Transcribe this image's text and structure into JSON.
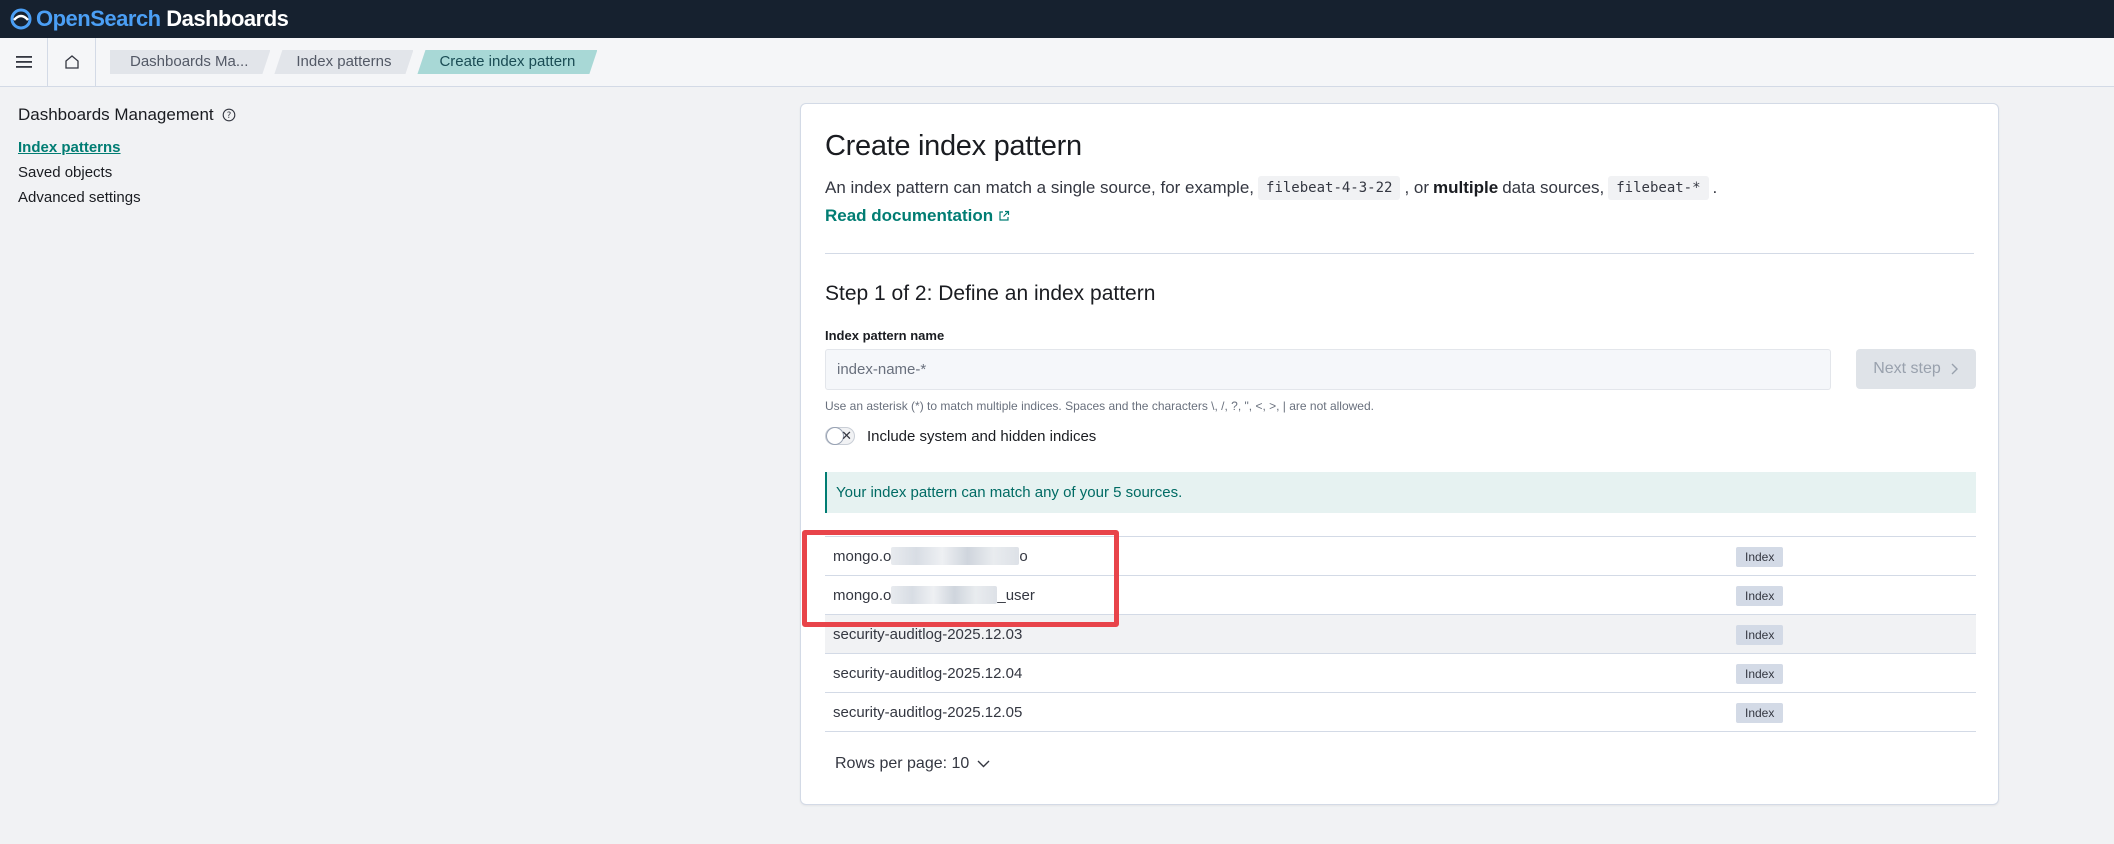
{
  "header": {
    "brand_open": "Open",
    "brand_search": "Search",
    "brand_dashboards": " Dashboards"
  },
  "breadcrumbs": [
    {
      "label": "Dashboards Ma..."
    },
    {
      "label": "Index patterns"
    },
    {
      "label": "Create index pattern"
    }
  ],
  "sidebar": {
    "title": "Dashboards Management",
    "items": [
      {
        "label": "Index patterns",
        "active": true
      },
      {
        "label": "Saved objects",
        "active": false
      },
      {
        "label": "Advanced settings",
        "active": false
      }
    ]
  },
  "page": {
    "title": "Create index pattern",
    "desc_1": "An index pattern can match a single source, for example,",
    "desc_code_1": "filebeat-4-3-22",
    "desc_2": ", or",
    "desc_bold": "multiple",
    "desc_3": "data sources,",
    "desc_code_2": "filebeat-*",
    "desc_4": ".",
    "doc_link": "Read documentation"
  },
  "step": {
    "title": "Step 1 of 2: Define an index pattern",
    "field_label": "Index pattern name",
    "input_value": "",
    "input_placeholder": "index-name-*",
    "next_button": "Next step",
    "help_text": "Use an asterisk (*) to match multiple indices. Spaces and the characters \\, /, ?, \", <, >, | are not allowed.",
    "toggle_label": "Include system and hidden indices",
    "toggle_on": false,
    "callout": "Your index pattern can match any of your 5 sources."
  },
  "table": {
    "rows": [
      {
        "name_prefix": "mongo.o",
        "name_suffix": "o",
        "redacted": true,
        "type": "Index"
      },
      {
        "name_prefix": "mongo.o",
        "name_suffix": "_user",
        "redacted": true,
        "type": "Index"
      },
      {
        "name": "security-auditlog-2025.12.03",
        "redacted": false,
        "type": "Index"
      },
      {
        "name": "security-auditlog-2025.12.04",
        "redacted": false,
        "type": "Index"
      },
      {
        "name": "security-auditlog-2025.12.05",
        "redacted": false,
        "type": "Index"
      }
    ],
    "rows_per_page": "Rows per page: 10"
  },
  "colors": {
    "accent": "#017d73",
    "annotation": "#e8444a",
    "header_bg": "#16212f"
  }
}
